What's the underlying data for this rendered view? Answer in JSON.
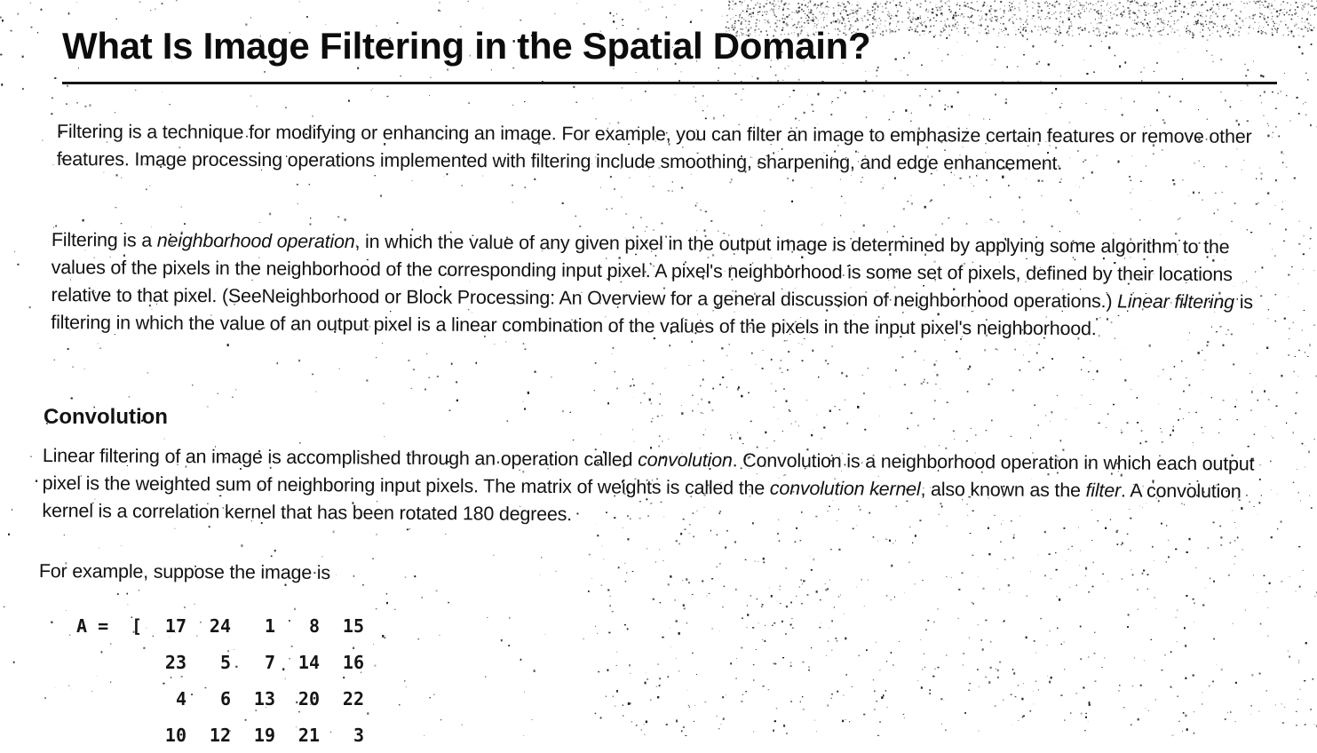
{
  "document": {
    "title": "What Is Image Filtering in the Spatial Domain?",
    "paragraph_1": "Filtering is a technique for modifying or enhancing an image. For example, you can filter an image to emphasize certain features or remove other features. Image processing operations implemented with filtering include smoothing, sharpening, and edge enhancement.",
    "paragraph_2": {
      "part_1": "Filtering is a ",
      "term_1": "neighborhood operation",
      "part_2": ", in which the value of any given pixel in the output image is determined by applying some algorithm to the values of the pixels in the neighborhood of the corresponding input pixel. A pixel's neighborhood is some set of pixels, defined by their locations relative to that pixel. (SeeNeighborhood or Block Processing: An Overview for a general discussion of neighborhood operations.) ",
      "term_2": "Linear filtering",
      "part_3": " is filtering in which the value of an output pixel is a linear combination of the values of the pixels in the input pixel's neighborhood."
    },
    "section_heading": "Convolution",
    "paragraph_3": {
      "part_1": "Linear filtering of an image is accomplished through an operation called ",
      "term_1": "convolution",
      "part_2": ". Convolution is a neighborhood operation in which each output pixel is the weighted sum of neighboring input pixels. The matrix of weights is called the ",
      "term_2": "convolution kernel",
      "part_3": ", also known as the ",
      "term_3": "filter",
      "part_4": ". A convolution kernel is a correlation kernel that has been rotated 180 degrees."
    },
    "paragraph_4": "For example, suppose the image is",
    "matrix": {
      "prefix": "A = ",
      "bracket": "[",
      "rows": [
        [
          "17",
          "24",
          "1",
          "8",
          "15"
        ],
        [
          "23",
          "5",
          "7",
          "14",
          "16"
        ],
        [
          "4",
          "6",
          "13",
          "20",
          "22"
        ],
        [
          "10",
          "12",
          "19",
          "21",
          "3"
        ]
      ]
    }
  }
}
